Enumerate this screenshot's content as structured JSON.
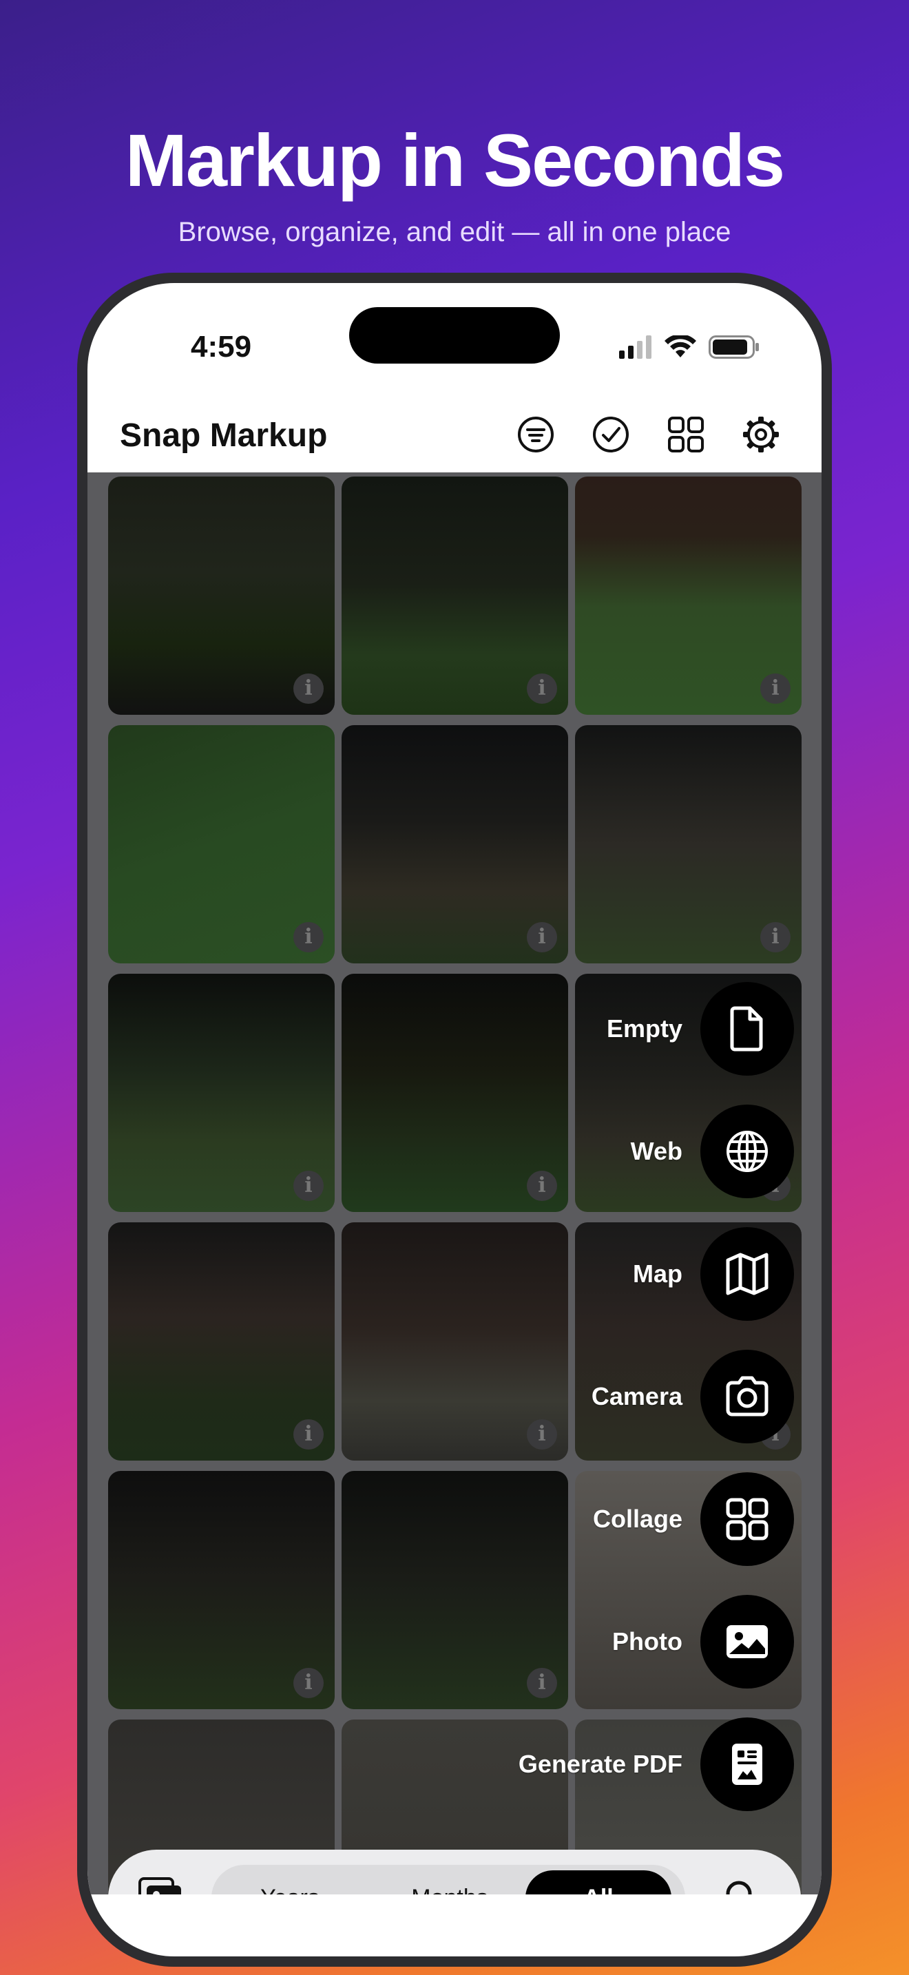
{
  "headline": "Markup in Seconds",
  "subhead": "Browse, organize, and edit — all in one place",
  "status_bar": {
    "time": "4:59"
  },
  "app": {
    "title": "Snap Markup",
    "nav_icons": [
      "filter-icon",
      "select-check-icon",
      "grid-layout-icon",
      "gear-icon"
    ]
  },
  "grid": {
    "info_label": "i",
    "tile_count": 18
  },
  "fab_menu": {
    "items": [
      {
        "label": "Empty",
        "icon": "blank-document-icon"
      },
      {
        "label": "Web",
        "icon": "globe-icon"
      },
      {
        "label": "Map",
        "icon": "map-icon"
      },
      {
        "label": "Camera",
        "icon": "camera-icon"
      },
      {
        "label": "Collage",
        "icon": "collage-icon"
      },
      {
        "label": "Photo",
        "icon": "photo-icon"
      },
      {
        "label": "Generate PDF",
        "icon": "pdf-document-icon"
      }
    ],
    "close_icon": "close-icon"
  },
  "bottom_bar": {
    "segments": [
      "Years",
      "Months",
      "All"
    ],
    "selected": "All",
    "left_icon": "photo-library-icon",
    "right_icon": "search-icon"
  }
}
